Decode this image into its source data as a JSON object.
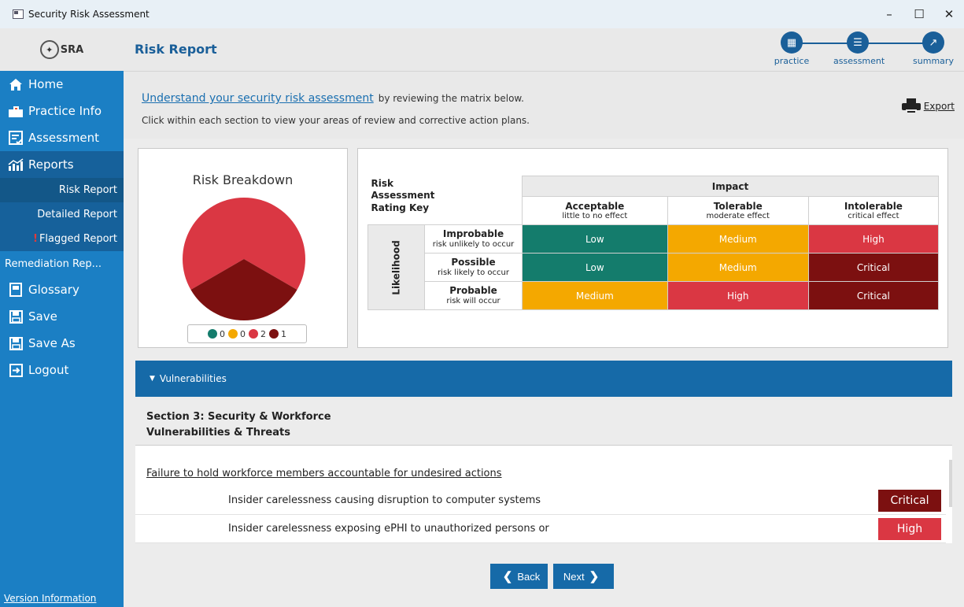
{
  "window": {
    "title": "Security Risk Assessment",
    "controls": {
      "minimize": "–",
      "maximize": "☐",
      "close": "✕"
    }
  },
  "logo": {
    "text": "SRA"
  },
  "sidebar": {
    "items": [
      {
        "label": "Home",
        "icon": "home-icon"
      },
      {
        "label": "Practice Info",
        "icon": "buildings-icon"
      },
      {
        "label": "Assessment",
        "icon": "checklist-icon"
      },
      {
        "label": "Reports",
        "icon": "chart-icon"
      }
    ],
    "report_items": [
      {
        "label": "Risk Report"
      },
      {
        "label": "Detailed Report"
      },
      {
        "label": "Flagged Report",
        "flag": "!"
      }
    ],
    "remediation": "Remediation Rep...",
    "bottom_items": [
      {
        "label": "Glossary",
        "icon": "book-icon"
      },
      {
        "label": "Save",
        "icon": "save-icon"
      },
      {
        "label": "Save As",
        "icon": "save-as-icon"
      },
      {
        "label": "Logout",
        "icon": "logout-icon"
      }
    ],
    "version": "Version Information"
  },
  "header": {
    "title": "Risk Report",
    "steps": [
      {
        "label": "practice",
        "icon": "practice-icon"
      },
      {
        "label": "assessment",
        "icon": "assessment-icon"
      },
      {
        "label": "summary",
        "icon": "summary-icon"
      }
    ]
  },
  "intro": {
    "link": "Understand your security risk assessment",
    "line1_rest": "by reviewing the matrix below.",
    "line2": "Click within each section to view your areas of review and corrective action plans.",
    "export": "Export"
  },
  "chart_data": {
    "type": "pie",
    "title": "Risk Breakdown",
    "categories": [
      "Low",
      "Medium",
      "High",
      "Critical"
    ],
    "values": [
      0,
      0,
      2,
      1
    ],
    "colors": [
      "#147c6c",
      "#f4a800",
      "#da3743",
      "#7c1010"
    ]
  },
  "matrix": {
    "key_title": [
      "Risk",
      "Assessment",
      "Rating Key"
    ],
    "impact": "Impact",
    "likelihood": "Likelihood",
    "columns": [
      {
        "title": "Acceptable",
        "sub": "little to no effect"
      },
      {
        "title": "Tolerable",
        "sub": "moderate effect"
      },
      {
        "title": "Intolerable",
        "sub": "critical effect"
      }
    ],
    "rows": [
      {
        "title": "Improbable",
        "sub": "risk unlikely to occur",
        "cells": [
          "Low",
          "Medium",
          "High"
        ]
      },
      {
        "title": "Possible",
        "sub": "risk likely to occur",
        "cells": [
          "Low",
          "Medium",
          "Critical"
        ]
      },
      {
        "title": "Probable",
        "sub": "risk will occur",
        "cells": [
          "Medium",
          "High",
          "Critical"
        ]
      }
    ],
    "level_colors": {
      "Low": "#147c6c",
      "Medium": "#f4a800",
      "High": "#da3743",
      "Critical": "#7c1010"
    }
  },
  "vulnerabilities": {
    "header": "Vulnerabilities",
    "section_title": "Section 3: Security & Workforce",
    "section_sub": "Vulnerabilities & Threats",
    "failure": "Failure to hold workforce members accountable for undesired actions",
    "threats": [
      {
        "text": "Insider carelessness causing disruption to computer systems",
        "level": "Critical"
      },
      {
        "text": "Insider carelessness exposing ePHI to unauthorized persons or",
        "level": "High"
      }
    ]
  },
  "footer": {
    "back": "Back",
    "next": "Next"
  }
}
